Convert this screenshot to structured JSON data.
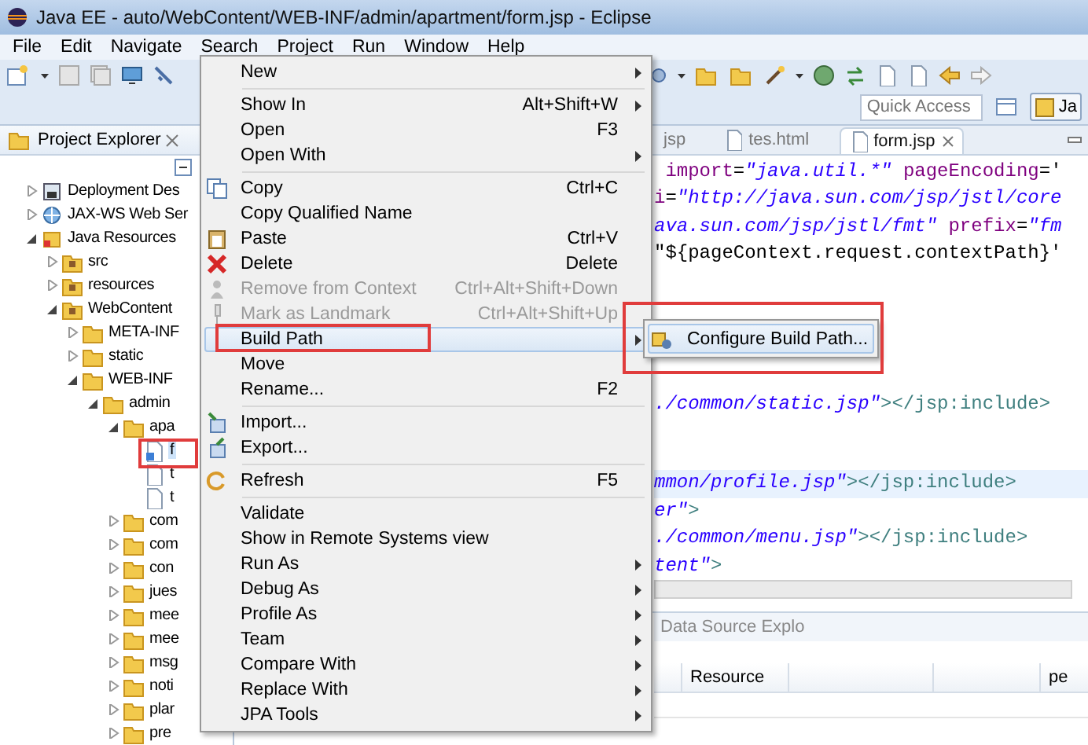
{
  "window": {
    "title": "Java EE - auto/WebContent/WEB-INF/admin/apartment/form.jsp - Eclipse"
  },
  "menu_bar": [
    "File",
    "Edit",
    "Navigate",
    "Search",
    "Project",
    "Run",
    "Window",
    "Help"
  ],
  "toolbar": {
    "quick_access": {
      "placeholder": "Quick Access"
    },
    "perspective": {
      "label": "Ja"
    }
  },
  "project_explorer": {
    "title": "Project Explorer",
    "tree": [
      {
        "label": "Deployment Des",
        "kind": "deployment",
        "expanded": false,
        "selected": false
      },
      {
        "label": "JAX-WS Web Ser",
        "kind": "webservice",
        "expanded": false,
        "selected": false
      },
      {
        "label": "Java Resources",
        "kind": "java",
        "expanded": true,
        "selected": false,
        "children": [
          {
            "label": "src",
            "kind": "package-folder",
            "expanded": false,
            "selected": false
          },
          {
            "label": "resources",
            "kind": "package-folder",
            "expanded": false,
            "selected": false
          },
          {
            "label": "WebContent",
            "kind": "package-folder",
            "expanded": true,
            "selected": false,
            "children": [
              {
                "label": "META-INF",
                "kind": "folder",
                "expanded": false,
                "selected": false
              },
              {
                "label": "static",
                "kind": "folder",
                "expanded": false,
                "selected": false
              },
              {
                "label": "WEB-INF",
                "kind": "folder",
                "expanded": true,
                "selected": false,
                "children": [
                  {
                    "label": "admin",
                    "kind": "folder",
                    "expanded": true,
                    "selected": false,
                    "children": [
                      {
                        "label": "apa",
                        "kind": "folder",
                        "expanded": true,
                        "selected": false,
                        "children": [
                          {
                            "label": "f",
                            "kind": "jsp",
                            "selected": true
                          },
                          {
                            "label": "t",
                            "kind": "file",
                            "selected": false
                          },
                          {
                            "label": "t",
                            "kind": "file",
                            "selected": false
                          }
                        ]
                      },
                      {
                        "label": "com",
                        "kind": "folder",
                        "expanded": false,
                        "selected": false
                      },
                      {
                        "label": "com",
                        "kind": "folder",
                        "expanded": false,
                        "selected": false
                      },
                      {
                        "label": "con",
                        "kind": "folder",
                        "expanded": false,
                        "selected": false
                      },
                      {
                        "label": "jues",
                        "kind": "folder",
                        "expanded": false,
                        "selected": false
                      },
                      {
                        "label": "mee",
                        "kind": "folder",
                        "expanded": false,
                        "selected": false
                      },
                      {
                        "label": "mee",
                        "kind": "folder",
                        "expanded": false,
                        "selected": false
                      },
                      {
                        "label": "msg",
                        "kind": "folder",
                        "expanded": false,
                        "selected": false
                      },
                      {
                        "label": "noti",
                        "kind": "folder",
                        "expanded": false,
                        "selected": false
                      },
                      {
                        "label": "plar",
                        "kind": "folder",
                        "expanded": false,
                        "selected": false
                      },
                      {
                        "label": "pre",
                        "kind": "folder",
                        "expanded": false,
                        "selected": false
                      }
                    ]
                  }
                ]
              }
            ]
          }
        ]
      }
    ]
  },
  "editor": {
    "tabs": [
      {
        "label": "jsp",
        "selected": false
      },
      {
        "label": "tes.html",
        "selected": false
      },
      {
        "label": "form.jsp",
        "selected": true
      }
    ],
    "code_top": [
      {
        "highlighted": false,
        "tokens": [
          {
            "text": " import",
            "kind": "attr"
          },
          {
            "text": "=",
            "kind": "plain"
          },
          {
            "text": "\"java.util.*\"",
            "kind": "string"
          },
          {
            "text": " pageEncoding",
            "kind": "attr"
          },
          {
            "text": "='",
            "kind": "plain"
          }
        ]
      },
      {
        "highlighted": false,
        "tokens": [
          {
            "text": "i",
            "kind": "attr"
          },
          {
            "text": "=",
            "kind": "plain"
          },
          {
            "text": "\"http://java.sun.com/jsp/jstl/core",
            "kind": "string"
          }
        ]
      },
      {
        "highlighted": false,
        "tokens": [
          {
            "text": "ava.sun.com/jsp/jstl/fmt\"",
            "kind": "string"
          },
          {
            "text": " prefix",
            "kind": "attr"
          },
          {
            "text": "=",
            "kind": "plain"
          },
          {
            "text": "\"fm",
            "kind": "string"
          }
        ]
      },
      {
        "highlighted": false,
        "tokens": [
          {
            "text": "\"${pageContext.request.contextPath}'",
            "kind": "plain"
          }
        ]
      }
    ],
    "code_middle": [
      {
        "highlighted": false,
        "tokens": [
          {
            "text": "./common/static.jsp\"",
            "kind": "string"
          },
          {
            "text": "></jsp:include>",
            "kind": "tag"
          }
        ]
      }
    ],
    "code_bottom": [
      {
        "highlighted": true,
        "tokens": [
          {
            "text": "mmon/profile.jsp\"",
            "kind": "string"
          },
          {
            "text": "></jsp:include>",
            "kind": "tag"
          }
        ]
      },
      {
        "highlighted": false,
        "tokens": [
          {
            "text": "er\"",
            "kind": "string"
          },
          {
            "text": ">",
            "kind": "tag"
          }
        ]
      },
      {
        "highlighted": false,
        "tokens": [
          {
            "text": "./common/menu.jsp\"",
            "kind": "string"
          },
          {
            "text": "></jsp:include>",
            "kind": "tag"
          }
        ]
      },
      {
        "highlighted": false,
        "tokens": [
          {
            "text": "tent\"",
            "kind": "string"
          },
          {
            "text": ">",
            "kind": "tag"
          }
        ]
      }
    ]
  },
  "bottom_panel": {
    "tab": "Data Source Explo",
    "columns": [
      "Resource",
      "pe"
    ]
  },
  "context_menu": {
    "items": [
      {
        "kind": "item",
        "label": "New",
        "submenu": true,
        "disabled": false,
        "selected": false
      },
      {
        "kind": "separator"
      },
      {
        "kind": "item",
        "label": "Show In",
        "shortcut": "Alt+Shift+W",
        "submenu": true,
        "disabled": false,
        "selected": false
      },
      {
        "kind": "item",
        "label": "Open",
        "shortcut": "F3",
        "submenu": false,
        "disabled": false,
        "selected": false
      },
      {
        "kind": "item",
        "label": "Open With",
        "submenu": true,
        "disabled": false,
        "selected": false
      },
      {
        "kind": "separator"
      },
      {
        "kind": "item",
        "label": "Copy",
        "shortcut": "Ctrl+C",
        "submenu": false,
        "disabled": false,
        "selected": false
      },
      {
        "kind": "item",
        "label": "Copy Qualified Name",
        "submenu": false,
        "disabled": false,
        "selected": false
      },
      {
        "kind": "item",
        "label": "Paste",
        "shortcut": "Ctrl+V",
        "submenu": false,
        "disabled": false,
        "selected": false
      },
      {
        "kind": "item",
        "label": "Delete",
        "shortcut": "Delete",
        "submenu": false,
        "disabled": false,
        "selected": false
      },
      {
        "kind": "item",
        "label": "Remove from Context",
        "shortcut": "Ctrl+Alt+Shift+Down",
        "submenu": false,
        "disabled": true,
        "selected": false
      },
      {
        "kind": "item",
        "label": "Mark as Landmark",
        "shortcut": "Ctrl+Alt+Shift+Up",
        "submenu": false,
        "disabled": true,
        "selected": false
      },
      {
        "kind": "item",
        "label": "Build Path",
        "submenu": true,
        "disabled": false,
        "selected": true
      },
      {
        "kind": "item",
        "label": "Move",
        "submenu": false,
        "disabled": false,
        "selected": false
      },
      {
        "kind": "item",
        "label": "Rename...",
        "shortcut": "F2",
        "submenu": false,
        "disabled": false,
        "selected": false
      },
      {
        "kind": "separator"
      },
      {
        "kind": "item",
        "label": "Import...",
        "submenu": false,
        "disabled": false,
        "selected": false
      },
      {
        "kind": "item",
        "label": "Export...",
        "submenu": false,
        "disabled": false,
        "selected": false
      },
      {
        "kind": "separator"
      },
      {
        "kind": "item",
        "label": "Refresh",
        "shortcut": "F5",
        "submenu": false,
        "disabled": false,
        "selected": false
      },
      {
        "kind": "separator"
      },
      {
        "kind": "item",
        "label": "Validate",
        "submenu": false,
        "disabled": false,
        "selected": false
      },
      {
        "kind": "item",
        "label": "Show in Remote Systems view",
        "submenu": false,
        "disabled": false,
        "selected": false
      },
      {
        "kind": "item",
        "label": "Run As",
        "submenu": true,
        "disabled": false,
        "selected": false
      },
      {
        "kind": "item",
        "label": "Debug As",
        "submenu": true,
        "disabled": false,
        "selected": false
      },
      {
        "kind": "item",
        "label": "Profile As",
        "submenu": true,
        "disabled": false,
        "selected": false
      },
      {
        "kind": "item",
        "label": "Team",
        "submenu": true,
        "disabled": false,
        "selected": false
      },
      {
        "kind": "item",
        "label": "Compare With",
        "submenu": true,
        "disabled": false,
        "selected": false
      },
      {
        "kind": "item",
        "label": "Replace With",
        "submenu": true,
        "disabled": false,
        "selected": false
      },
      {
        "kind": "item",
        "label": "JPA Tools",
        "submenu": true,
        "disabled": false,
        "selected": false
      }
    ]
  },
  "submenu": {
    "items": [
      {
        "label": "Configure Build Path...",
        "selected": true
      }
    ]
  }
}
